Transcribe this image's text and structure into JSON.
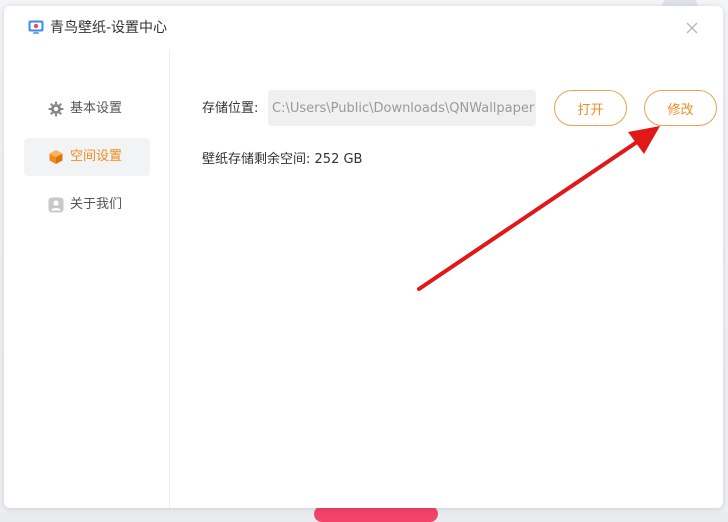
{
  "window": {
    "title": "青鸟壁纸-设置中心",
    "close_label": "×"
  },
  "sidebar": {
    "items": [
      {
        "label": "基本设置",
        "icon": "gear-icon",
        "active": false
      },
      {
        "label": "空间设置",
        "icon": "cube-icon",
        "active": true
      },
      {
        "label": "关于我们",
        "icon": "user-icon",
        "active": false
      }
    ]
  },
  "storage": {
    "location_label": "存储位置:",
    "path_value": "C:\\Users\\Public\\Downloads\\QNWallpaper",
    "open_button": "打开",
    "modify_button": "修改",
    "free_space_label": "壁纸存储剩余空间:",
    "free_space_value": "252 GB"
  },
  "colors": {
    "accent": "#f08c1e",
    "annotation_arrow": "#e01818"
  }
}
